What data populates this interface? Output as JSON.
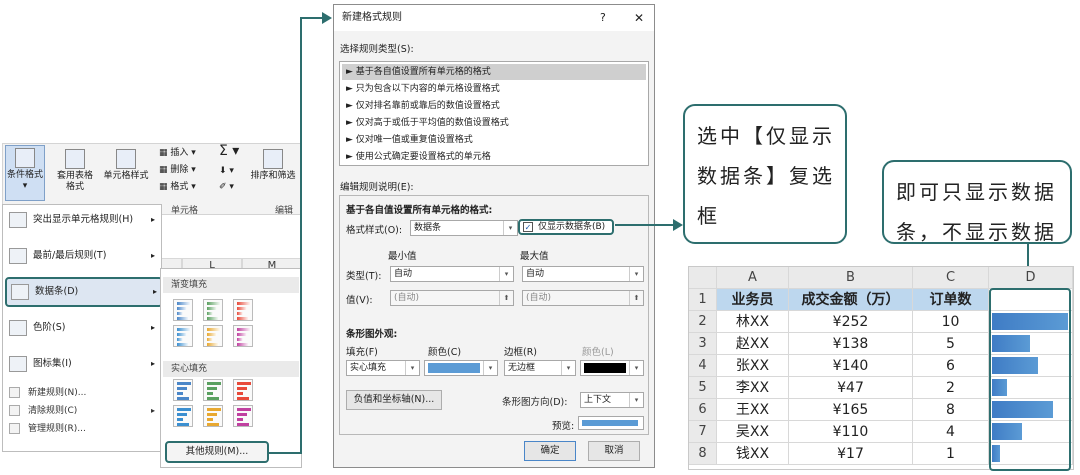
{
  "ribbon": {
    "cond_format": "条件格式",
    "table_format": "套用表格格式",
    "cell_style": "单元格样式",
    "insert": "插入",
    "delete": "删除",
    "format": "格式",
    "sum_symbol": "Σ",
    "sort_filter": "排序和筛选",
    "group_cells": "单元格",
    "group_edit": "编辑"
  },
  "sheet_cols": [
    "L",
    "M"
  ],
  "menu": {
    "items": [
      {
        "label": "突出显示单元格规则(H)",
        "icon": "highlight-rules-icon",
        "arrow": "▸"
      },
      {
        "label": "最前/最后规则(T)",
        "icon": "top-bottom-icon",
        "arrow": "▸"
      },
      {
        "label": "数据条(D)",
        "icon": "data-bars-icon",
        "arrow": "▸"
      },
      {
        "label": "色阶(S)",
        "icon": "color-scale-icon",
        "arrow": "▸"
      },
      {
        "label": "图标集(I)",
        "icon": "icon-sets-icon",
        "arrow": "▸"
      }
    ],
    "small_items": [
      {
        "label": "新建规则(N)...",
        "arrow": ""
      },
      {
        "label": "清除规则(C)",
        "arrow": "▸"
      },
      {
        "label": "管理规则(R)...",
        "arrow": ""
      }
    ]
  },
  "submenu": {
    "gradient_header": "渐变填充",
    "solid_header": "实心填充",
    "other_rules": "其他规则(M)..."
  },
  "dialog": {
    "title": "新建格式规则",
    "help": "?",
    "close": "✕",
    "select_type_label": "选择规则类型(S):",
    "rule_types": [
      "► 基于各自值设置所有单元格的格式",
      "► 只为包含以下内容的单元格设置格式",
      "► 仅对排名靠前或靠后的数值设置格式",
      "► 仅对高于或低于平均值的数值设置格式",
      "► 仅对唯一值或重复值设置格式",
      "► 使用公式确定要设置格式的单元格"
    ],
    "edit_desc_label": "编辑规则说明(E):",
    "desc_heading": "基于各自值设置所有单元格的格式:",
    "format_style_label": "格式样式(O):",
    "format_style_value": "数据条",
    "show_bar_only": "仅显示数据条(B)",
    "min_label": "最小值",
    "max_label": "最大值",
    "type_label": "类型(T):",
    "type_min": "自动",
    "type_max": "自动",
    "value_label": "值(V):",
    "value_min": "(自动)",
    "value_max": "(自动)",
    "bar_appearance": "条形图外观:",
    "fill_label": "填充(F)",
    "color_label": "颜色(C)",
    "border_label": "边框(R)",
    "border_color_label": "颜色(L)",
    "fill_value": "实心填充",
    "border_value": "无边框",
    "neg_axis_button": "负值和坐标轴(N)...",
    "bar_dir_label": "条形图方向(D):",
    "bar_dir_value": "上下文",
    "preview_label": "预览:",
    "ok": "确定",
    "cancel": "取消"
  },
  "callouts": {
    "left": "选中【仅显示数据条】复选框",
    "right": "即可只显示数据条，不显示数据"
  },
  "table": {
    "col_letters": [
      "A",
      "B",
      "C",
      "D"
    ],
    "row_numbers": [
      "1",
      "2",
      "3",
      "4",
      "5",
      "6",
      "7",
      "8"
    ],
    "headers": [
      "业务员",
      "成交金额（万）",
      "订单数"
    ],
    "rows": [
      {
        "name": "林XX",
        "amount": "¥252",
        "orders": "10"
      },
      {
        "name": "赵XX",
        "amount": "¥138",
        "orders": "5"
      },
      {
        "name": "张XX",
        "amount": "¥140",
        "orders": "6"
      },
      {
        "name": "李XX",
        "amount": "¥47",
        "orders": "2"
      },
      {
        "name": "王XX",
        "amount": "¥165",
        "orders": "8"
      },
      {
        "name": "吴XX",
        "amount": "¥110",
        "orders": "4"
      },
      {
        "name": "钱XX",
        "amount": "¥17",
        "orders": "1"
      }
    ],
    "bar_values": [
      10,
      5,
      6,
      2,
      8,
      4,
      1
    ],
    "bar_max": 10
  },
  "colors": {
    "accent": "#2d6e6e",
    "bar": "#4a86c8",
    "header_fill": "#bdd7ee"
  }
}
